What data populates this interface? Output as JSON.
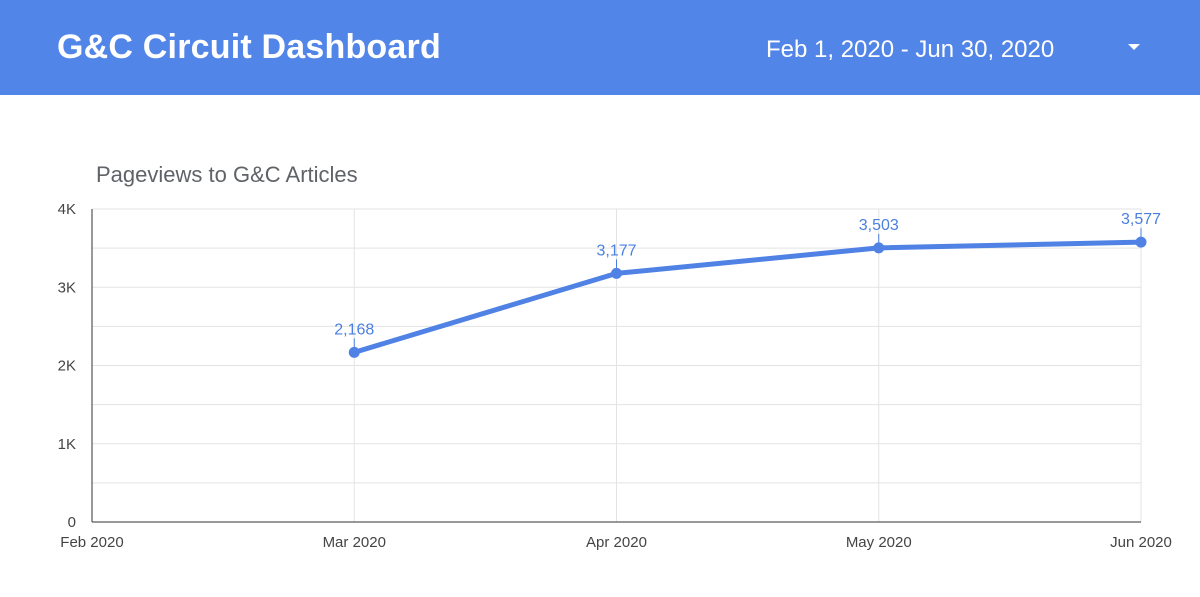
{
  "header": {
    "title": "G&C Circuit Dashboard",
    "date_range": "Feb 1, 2020 - Jun 30, 2020",
    "dropdown_icon": "caret-down-icon"
  },
  "colors": {
    "header_bg": "#5285e8",
    "series": "#4f82e4",
    "data_label": "#4a7fe0",
    "grid": "#e3e3e3"
  },
  "chart_data": {
    "type": "line",
    "title": "Pageviews to G&C Articles",
    "xlabel": "",
    "ylabel": "",
    "categories": [
      "Feb 2020",
      "Mar 2020",
      "Apr 2020",
      "May 2020",
      "Jun 2020"
    ],
    "series": [
      {
        "values": [
          null,
          2168,
          3177,
          3503,
          3577
        ]
      }
    ],
    "data_labels": [
      "",
      "2,168",
      "3,177",
      "3,503",
      "3,577"
    ],
    "y_ticks": [
      0,
      1000,
      2000,
      3000,
      4000
    ],
    "y_tick_labels": [
      "0",
      "1K",
      "2K",
      "3K",
      "4K"
    ],
    "ylim": [
      0,
      4000
    ],
    "grid": true,
    "legend": "none"
  }
}
